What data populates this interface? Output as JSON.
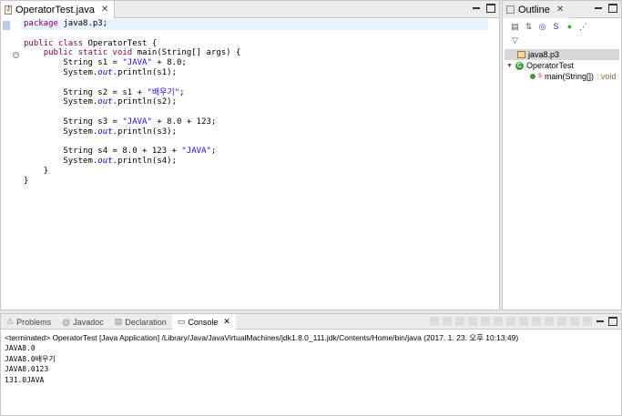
{
  "editor": {
    "tab_title": "OperatorTest.java",
    "code_lines": [
      [
        {
          "t": "package",
          "c": "kw"
        },
        {
          "t": " java8.p3;"
        }
      ],
      [
        {
          "t": ""
        }
      ],
      [
        {
          "t": "public class",
          "c": "kw"
        },
        {
          "t": " OperatorTest {"
        }
      ],
      [
        {
          "t": "    "
        },
        {
          "t": "public static void",
          "c": "kw"
        },
        {
          "t": " main(String[] args) {"
        }
      ],
      [
        {
          "t": "        String s1 = "
        },
        {
          "t": "\"JAVA\"",
          "c": "str"
        },
        {
          "t": " + 8.0;"
        }
      ],
      [
        {
          "t": "        System."
        },
        {
          "t": "out",
          "c": "fld"
        },
        {
          "t": ".println(s1);"
        }
      ],
      [
        {
          "t": ""
        }
      ],
      [
        {
          "t": "        String s2 = s1 + "
        },
        {
          "t": "\"배우기\"",
          "c": "str"
        },
        {
          "t": ";"
        }
      ],
      [
        {
          "t": "        System."
        },
        {
          "t": "out",
          "c": "fld"
        },
        {
          "t": ".println(s2);"
        }
      ],
      [
        {
          "t": ""
        }
      ],
      [
        {
          "t": "        String s3 = "
        },
        {
          "t": "\"JAVA\"",
          "c": "str"
        },
        {
          "t": " + 8.0 + 123;"
        }
      ],
      [
        {
          "t": "        System."
        },
        {
          "t": "out",
          "c": "fld"
        },
        {
          "t": ".println(s3);"
        }
      ],
      [
        {
          "t": ""
        }
      ],
      [
        {
          "t": "        String s4 = 8.0 + 123 + "
        },
        {
          "t": "\"JAVA\"",
          "c": "str"
        },
        {
          "t": ";"
        }
      ],
      [
        {
          "t": "        System."
        },
        {
          "t": "out",
          "c": "fld"
        },
        {
          "t": ".println(s4);"
        }
      ],
      [
        {
          "t": "    }"
        }
      ],
      [
        {
          "t": "}"
        }
      ]
    ]
  },
  "outline": {
    "tab_title": "Outline",
    "package": "java8.p3",
    "class_name": "OperatorTest",
    "method_name": "main(String[])",
    "method_return": " : void"
  },
  "console": {
    "tabs": [
      {
        "label": "Problems",
        "icon": "problems-icon"
      },
      {
        "label": "Javadoc",
        "icon": "javadoc-icon"
      },
      {
        "label": "Declaration",
        "icon": "declaration-icon"
      },
      {
        "label": "Console",
        "icon": "console-icon"
      }
    ],
    "terminated_line": "<terminated> OperatorTest [Java Application] /Library/Java/JavaVirtualMachines/jdk1.8.0_111.jdk/Contents/Home/bin/java (2017. 1. 23. 오후 10:13:49)",
    "output_lines": [
      "JAVA8.0",
      "JAVA8.0배우기",
      "JAVA8.0123",
      "131.0JAVA"
    ]
  },
  "colors": {
    "keyword": "#7f0055",
    "string": "#2a00ff",
    "field": "#0000c0"
  }
}
